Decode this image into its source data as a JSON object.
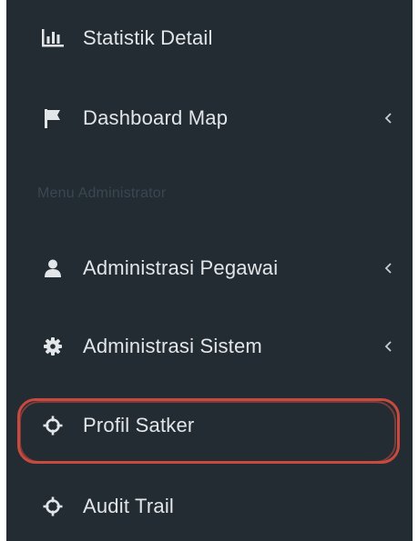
{
  "sidebar": {
    "background": "#232c33",
    "text_color": "#e3e6e8",
    "section_header": "Menu Administrator",
    "items": [
      {
        "label": "Statistik Detail",
        "icon": "bar-chart-icon",
        "has_submenu": false
      },
      {
        "label": "Dashboard Map",
        "icon": "flag-icon",
        "has_submenu": true
      },
      {
        "label": "Administrasi Pegawai",
        "icon": "user-icon",
        "has_submenu": true
      },
      {
        "label": "Administrasi Sistem",
        "icon": "gear-icon",
        "has_submenu": true
      },
      {
        "label": "Profil Satker",
        "icon": "crosshair-icon",
        "has_submenu": false,
        "highlighted": true
      },
      {
        "label": "Audit Trail",
        "icon": "crosshair-icon",
        "has_submenu": false
      }
    ]
  },
  "highlight": {
    "color": "#c84a3f",
    "target": "Profil Satker"
  }
}
